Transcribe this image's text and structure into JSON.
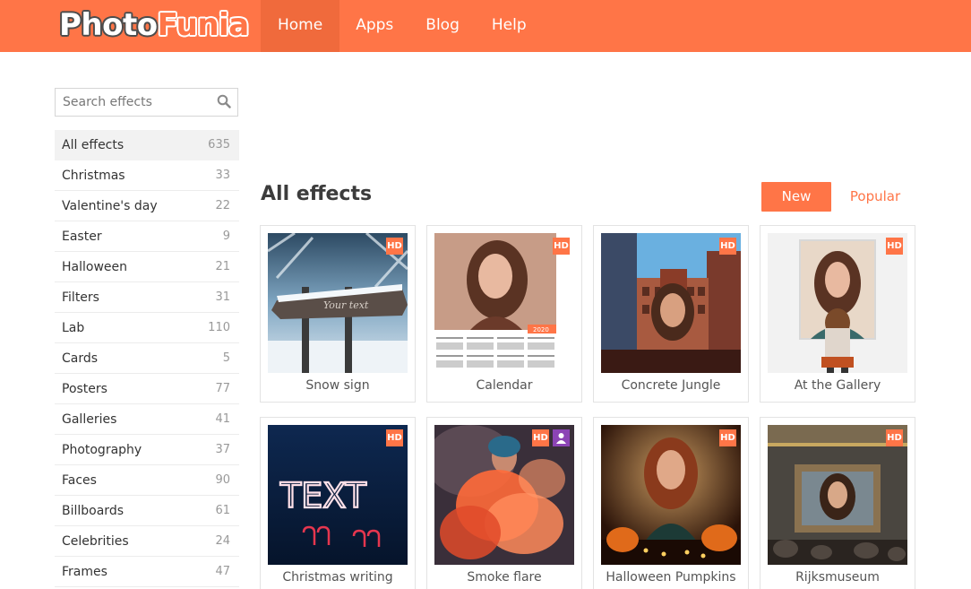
{
  "header": {
    "logo_part1": "Photo",
    "logo_part2": "Funia",
    "nav": [
      "Home",
      "Apps",
      "Blog",
      "Help"
    ]
  },
  "search": {
    "placeholder": "Search effects",
    "icon": "search-icon"
  },
  "categories": [
    {
      "label": "All effects",
      "count": "635"
    },
    {
      "label": "Christmas",
      "count": "33"
    },
    {
      "label": "Valentine's day",
      "count": "22"
    },
    {
      "label": "Easter",
      "count": "9"
    },
    {
      "label": "Halloween",
      "count": "21"
    },
    {
      "label": "Filters",
      "count": "31"
    },
    {
      "label": "Lab",
      "count": "110"
    },
    {
      "label": "Cards",
      "count": "5"
    },
    {
      "label": "Posters",
      "count": "77"
    },
    {
      "label": "Galleries",
      "count": "41"
    },
    {
      "label": "Photography",
      "count": "37"
    },
    {
      "label": "Faces",
      "count": "90"
    },
    {
      "label": "Billboards",
      "count": "61"
    },
    {
      "label": "Celebrities",
      "count": "24"
    },
    {
      "label": "Frames",
      "count": "47"
    }
  ],
  "main": {
    "title": "All effects",
    "sort_new": "New",
    "sort_popular": "Popular"
  },
  "badges": {
    "hd": "HD",
    "calendar_year": "2020",
    "text_effect": "TEXT",
    "sign_text": "Your text"
  },
  "effects": [
    {
      "label": "Snow sign",
      "hd": true
    },
    {
      "label": "Calendar",
      "hd": true
    },
    {
      "label": "Concrete Jungle",
      "hd": true
    },
    {
      "label": "At the Gallery",
      "hd": true
    },
    {
      "label": "Christmas writing",
      "hd": true
    },
    {
      "label": "Smoke flare",
      "hd": true,
      "face": true
    },
    {
      "label": "Halloween Pumpkins",
      "hd": true
    },
    {
      "label": "Rijksmuseum",
      "hd": true
    }
  ],
  "colors": {
    "brand": "#ff7547",
    "nav_active": "#f06a3c",
    "face_badge": "#8c44b5"
  }
}
